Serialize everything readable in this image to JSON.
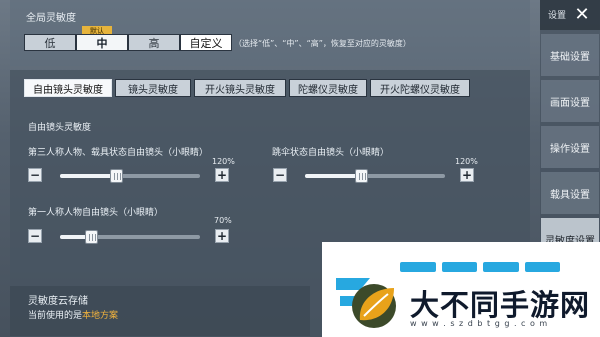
{
  "global": {
    "title": "全局灵敏度",
    "default_badge": "默认",
    "presets": [
      "低",
      "中",
      "高",
      "自定义"
    ],
    "note": "（选择“低”、“中”、“高”，恢复至对应的灵敏度）"
  },
  "tabs": [
    "自由镜头灵敏度",
    "镜头灵敏度",
    "开火镜头灵敏度",
    "陀螺仪灵敏度",
    "开火陀螺仪灵敏度"
  ],
  "free_camera": {
    "section_title": "自由镜头灵敏度",
    "sliders": [
      {
        "label": "第三人称人物、载具状态自由镜头（小眼睛）",
        "value_text": "120%",
        "level": 0.4
      },
      {
        "label": "跳伞状态自由镜头（小眼睛）",
        "value_text": "120%",
        "level": 0.4
      },
      {
        "label": "第一人称人物自由镜头（小眼睛）",
        "value_text": "70%",
        "level": 0.22
      }
    ],
    "minus": "−",
    "plus": "+"
  },
  "cloud": {
    "title": "灵敏度云存储",
    "current_prefix": "当前使用的是",
    "current_value": "本地方案",
    "highlight_color": "#f2b33d"
  },
  "sidebar": {
    "title": "设置",
    "close": "✕",
    "items": [
      "基础设置",
      "画面设置",
      "操作设置",
      "载具设置",
      "灵敏度设置"
    ]
  },
  "watermark": {
    "brand": "大不同手游网",
    "url": "w w w . s z d b t g g . c o m",
    "icon": "leaf-logo-icon"
  }
}
